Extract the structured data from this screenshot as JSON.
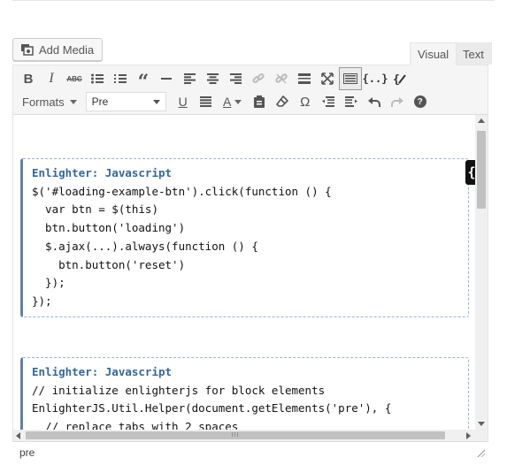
{
  "media": {
    "add_media_label": "Add Media"
  },
  "tabs": [
    {
      "label": "Visual"
    },
    {
      "label": "Text"
    }
  ],
  "toolbar": {
    "formats_label": "Formats",
    "block_format_value": "Pre",
    "row1_icons": [
      "bold-icon",
      "italic-icon",
      "strikethrough-icon",
      "bullet-list-icon",
      "numbered-list-icon",
      "blockquote-icon",
      "horizontal-line-icon",
      "align-left-icon",
      "align-center-icon",
      "align-right-icon",
      "insert-link-icon",
      "remove-link-icon",
      "read-more-icon",
      "fullscreen-icon",
      "toolbar-toggle-icon",
      "enlighter-code-icon",
      "enlighter-edit-icon"
    ],
    "row2_icons": [
      "underline-icon",
      "justify-icon",
      "text-color-icon",
      "paste-text-icon",
      "clear-formatting-icon",
      "special-character-icon",
      "outdent-icon",
      "indent-icon",
      "undo-icon",
      "redo-icon",
      "help-icon"
    ],
    "bold": "B",
    "italic": "I",
    "strike": "ABC",
    "underline": "U",
    "text_color": "A",
    "omega": "Ω",
    "code_braces": "{..}",
    "help": "?"
  },
  "code_blocks": [
    {
      "title": "Enlighter: Javascript",
      "lines": [
        "$('#loading-example-btn').click(function () {",
        "  var btn = $(this)",
        "  btn.button('loading')",
        "  $.ajax(...).always(function () {",
        "    btn.button('reset')",
        "  });",
        "});"
      ]
    },
    {
      "title": "Enlighter: Javascript",
      "lines": [
        "// initialize enlighterjs for block elements",
        "EnlighterJS.Util.Helper(document.getElements('pre'), {",
        "  // replace tabs with 2 spaces"
      ]
    }
  ],
  "block_handle": "{",
  "hscroll_grip": "III",
  "status": {
    "path": "pre"
  }
}
